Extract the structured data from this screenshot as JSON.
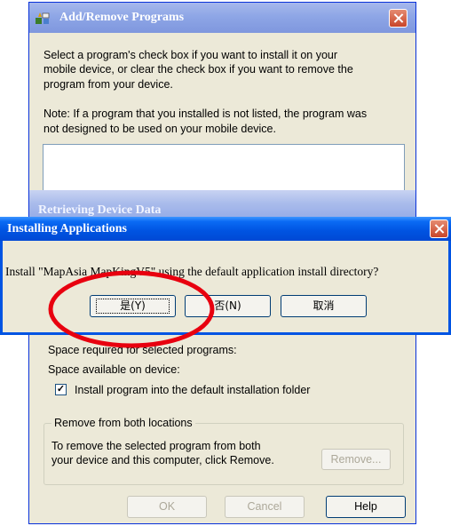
{
  "bg_window": {
    "title": "Add/Remove Programs",
    "intro_line1": "Select a program's check box if you want to install it on your",
    "intro_line2": "mobile device, or clear the check box if you want to remove the",
    "intro_line3": "program from your device.",
    "note_line1": "Note:  If a program that you installed is not listed, the program was",
    "note_line2": "not designed to be used on your mobile device.",
    "space_required_label": "Space required for selected programs:",
    "space_available_label": "Space available on device:",
    "install_default_checkbox": {
      "checked": true,
      "label": "Install program into the default installation folder"
    },
    "remove_group": {
      "title": "Remove from both locations",
      "line1": "To remove the selected program from both",
      "line2": "your device and this computer, click Remove.",
      "remove_button": "Remove..."
    },
    "ok_button": "OK",
    "cancel_button": "Cancel",
    "help_button": "Help"
  },
  "retrieving_window": {
    "title": "Retrieving Device Data"
  },
  "install_dialog": {
    "title": "Installing Applications",
    "message": "Install \"MapAsia MapKingV5\" using the default application install directory?",
    "yes_button": "是(Y)",
    "no_button": "否(N)",
    "cancel_button": "取消"
  },
  "annotation": {
    "color": "#e8000f"
  },
  "colors": {
    "title_blue": "#0054e3",
    "face": "#ece9d8"
  }
}
